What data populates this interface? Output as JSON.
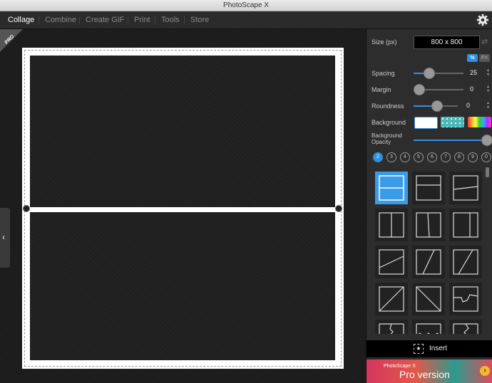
{
  "window": {
    "title": "PhotoScape X"
  },
  "menu": {
    "items": [
      "Collage",
      "Combine",
      "Create GIF",
      "Print",
      "Tools",
      "Store"
    ],
    "active": "Collage"
  },
  "canvas": {
    "pro_badge": "PRO"
  },
  "panel": {
    "size_label": "Size (px)",
    "size_value": "800 x 800",
    "unit_percent": "%",
    "unit_px": "PX",
    "spacing_label": "Spacing",
    "spacing_value": "25",
    "margin_label": "Margin",
    "margin_value": "0",
    "roundness_label": "Roundness",
    "roundness_value": "0",
    "background_label": "Background",
    "bg_opacity_label_line1": "Background",
    "bg_opacity_label_line2": "Opacity",
    "cell_counts": [
      "2",
      "3",
      "4",
      "5",
      "6",
      "7",
      "8",
      "9",
      "0"
    ],
    "selected_count": "2",
    "insert_label": "Insert",
    "pro_small": "PhotoScape X",
    "pro_big": "Pro version"
  },
  "colors": {
    "accent": "#2f8fe0",
    "selected_tile": "#3a9be8",
    "background": "#1c1c1c"
  }
}
